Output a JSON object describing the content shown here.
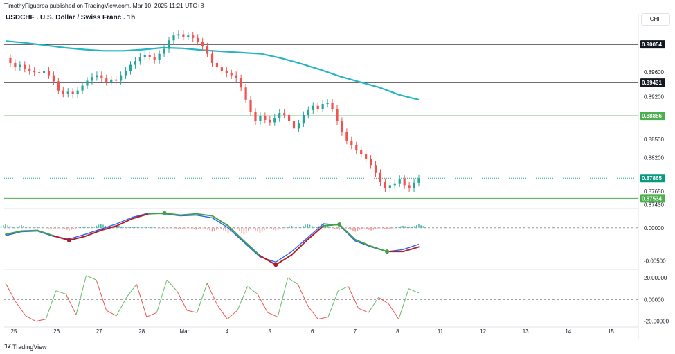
{
  "header": {
    "publisher_line": "TimothyFigueroa published on TradingView.com, Mar 10, 2025 11:21 UTC+8",
    "symbol_title": "USDCHF . U.S. Dollar / Swiss Franc . 1h",
    "currency": "CHF"
  },
  "footer": {
    "logo_text": "TradingView",
    "logo_mark": "17"
  },
  "colors": {
    "up": "#26a69a",
    "down": "#ef5350",
    "ma": "#26b5c4",
    "green_level": "#4caf50",
    "black_level": "#131722",
    "macd_line": "#2962ff",
    "macd_fast": "#b71c1c",
    "macd_green": "#43a047",
    "osc_up": "#66bb6a",
    "osc_down": "#ef5350"
  },
  "chart_data": [
    {
      "type": "candlestick",
      "title": "USDCHF . U.S. Dollar / Swiss Franc . 1h",
      "x_labels": [
        "25",
        "26",
        "27",
        "28",
        "Mar",
        "4",
        "5",
        "6",
        "7",
        "8",
        "11",
        "12",
        "13",
        "14",
        "15"
      ],
      "y_ticks": [
        "0.89600",
        "0.89200",
        "0.88500",
        "0.88200",
        "0.87650",
        "0.87430"
      ],
      "ylim": [
        0.8738,
        0.9035
      ],
      "price_tags": [
        {
          "value": "0.90054",
          "kind": "black"
        },
        {
          "value": "0.89431",
          "kind": "black"
        },
        {
          "value": "0.88886",
          "kind": "green"
        },
        {
          "value": "0.87865",
          "kind": "current"
        },
        {
          "value": "0.87534",
          "kind": "green"
        }
      ],
      "horizontal_levels": [
        0.90054,
        0.89431,
        0.88886,
        0.87534
      ],
      "close_path": [
        0.8983,
        0.8975,
        0.8968,
        0.8972,
        0.8966,
        0.8962,
        0.896,
        0.8958,
        0.8962,
        0.8955,
        0.8945,
        0.893,
        0.8925,
        0.8928,
        0.8924,
        0.893,
        0.8938,
        0.8946,
        0.8952,
        0.8955,
        0.895,
        0.8944,
        0.8948,
        0.8946,
        0.8955,
        0.8962,
        0.8972,
        0.8978,
        0.8985,
        0.8988,
        0.8985,
        0.898,
        0.899,
        0.8998,
        0.9012,
        0.902,
        0.9022,
        0.9018,
        0.902,
        0.9016,
        0.901,
        0.9002,
        0.899,
        0.8975,
        0.8968,
        0.8962,
        0.8958,
        0.8955,
        0.895,
        0.8935,
        0.8915,
        0.8895,
        0.888,
        0.8888,
        0.8882,
        0.8878,
        0.8885,
        0.8893,
        0.889,
        0.888,
        0.8868,
        0.8876,
        0.889,
        0.8898,
        0.8905,
        0.89,
        0.8908,
        0.891,
        0.89,
        0.888,
        0.8862,
        0.8848,
        0.884,
        0.8832,
        0.8826,
        0.8818,
        0.8808,
        0.8795,
        0.878,
        0.877,
        0.8775,
        0.8778,
        0.8785,
        0.8775,
        0.877,
        0.8779,
        0.87865
      ],
      "ma_path": [
        0.9011,
        0.9008,
        0.9004,
        0.9,
        0.8997,
        0.8995,
        0.8995,
        0.8997,
        0.9,
        0.8999,
        0.8996,
        0.8994,
        0.8992,
        0.899,
        0.8983,
        0.8974,
        0.8964,
        0.8953,
        0.8944,
        0.8935,
        0.8923,
        0.8915
      ],
      "x_range_active": [
        0,
        10
      ]
    },
    {
      "type": "line",
      "title": "",
      "y_ticks": [
        "0.00000",
        "-0.00500"
      ],
      "ylim": [
        -0.0062,
        0.0028
      ],
      "series": [
        {
          "role": "line1",
          "values": [
            -0.001,
            -0.0005,
            -0.0004,
            -0.0012,
            -0.0019,
            -0.0013,
            -0.0004,
            0.0003,
            0.0014,
            0.0021,
            0.0022,
            0.0019,
            0.0021,
            0.0018,
            0.0003,
            -0.002,
            -0.0042,
            -0.0056,
            -0.0041,
            -0.0018,
            0.0003,
            0.0005,
            -0.0018,
            -0.0028,
            -0.0036,
            -0.0036,
            -0.0029
          ]
        },
        {
          "role": "line2",
          "values": [
            -0.0012,
            -0.0006,
            -0.0005,
            -0.0013,
            -0.0017,
            -0.001,
            -0.0002,
            0.0006,
            0.0016,
            0.0022,
            0.0021,
            0.0018,
            0.0019,
            0.0015,
            0.0,
            -0.0022,
            -0.0044,
            -0.0052,
            -0.0036,
            -0.0015,
            0.0006,
            0.0004,
            -0.002,
            -0.0029,
            -0.0036,
            -0.0033,
            -0.0025
          ]
        },
        {
          "role": "histogram",
          "values": [
            0.0005,
            0.0004,
            0.0001,
            -0.0002,
            -0.0004,
            0.0002,
            0.0006,
            0.0004,
            0.0002,
            0.0001,
            -0.0001,
            -0.0002,
            -0.0003,
            -0.0006,
            -0.0008,
            -0.001,
            -0.0008,
            -0.0004,
            0.0003,
            0.0006,
            0.0005,
            -0.0003,
            -0.0006,
            -0.0004,
            -0.0002,
            0.0003,
            0.0005
          ]
        }
      ]
    },
    {
      "type": "line",
      "title": "",
      "y_ticks": [
        "20.00000",
        "0.00000",
        "-20.00000"
      ],
      "ylim": [
        -24,
        27
      ],
      "series": [
        {
          "role": "oscillator",
          "values": [
            15,
            -2,
            -15,
            -20,
            -18,
            8,
            5,
            -14,
            22,
            18,
            -10,
            -15,
            2,
            14,
            -16,
            -12,
            18,
            8,
            -10,
            -12,
            15,
            -5,
            -18,
            -10,
            12,
            5,
            -12,
            -16,
            20,
            14,
            -6,
            -18,
            -16,
            8,
            12,
            -8,
            -12,
            2,
            -4,
            -18,
            10,
            6
          ]
        }
      ]
    }
  ]
}
